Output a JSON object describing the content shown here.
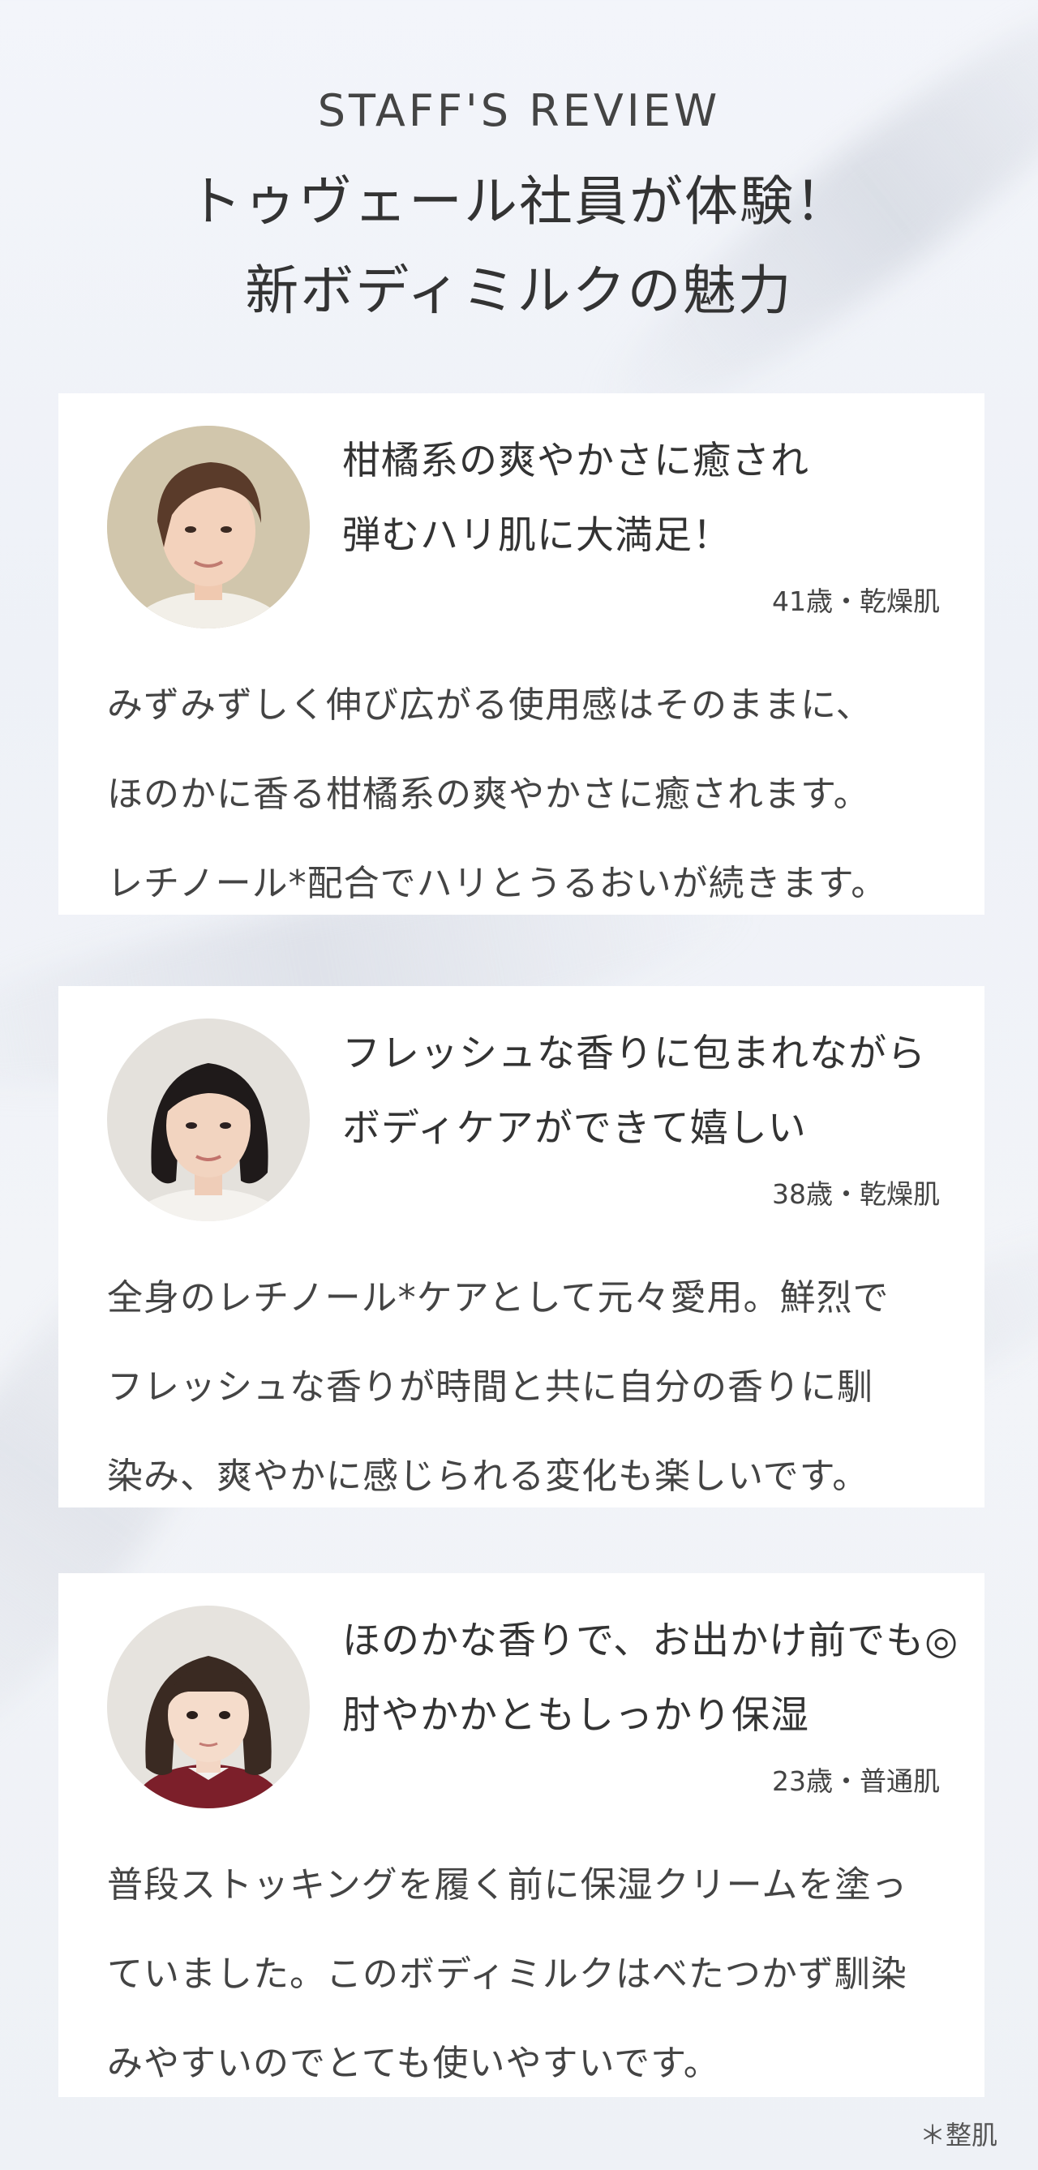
{
  "header": {
    "eyebrow": "STAFF'S REVIEW",
    "title_line1": "トゥヴェール社員が体験！",
    "title_line2": "新ボディミルクの魅力"
  },
  "reviews": [
    {
      "headline_line1": "柑橘系の爽やかさに癒され",
      "headline_line2": "弾むハリ肌に大満足！",
      "meta": "41歳・乾燥肌",
      "body_line1": "みずみずしく伸び広がる使用感はそのままに、",
      "body_line2": "ほのかに香る柑橘系の爽やかさに癒されます。",
      "body_line3": "レチノール*配合でハリとうるおいが続きます。"
    },
    {
      "headline_line1": "フレッシュな香りに包まれながら",
      "headline_line2": "ボディケアができて嬉しい",
      "meta": "38歳・乾燥肌",
      "body_line1": "全身のレチノール*ケアとして元々愛用。鮮烈で",
      "body_line2": "フレッシュな香りが時間と共に自分の香りに馴",
      "body_line3": "染み、爽やかに感じられる変化も楽しいです。"
    },
    {
      "headline_line1": "ほのかな香りで、お出かけ前でも◎",
      "headline_line2": "肘やかかともしっかり保湿",
      "meta": "23歳・普通肌",
      "body_line1": "普段ストッキングを履く前に保湿クリームを塗っ",
      "body_line2": "ていました。このボディミルクはべたつかず馴染",
      "body_line3": "みやすいのでとても使いやすいです。"
    }
  ],
  "footnote": "＊整肌"
}
